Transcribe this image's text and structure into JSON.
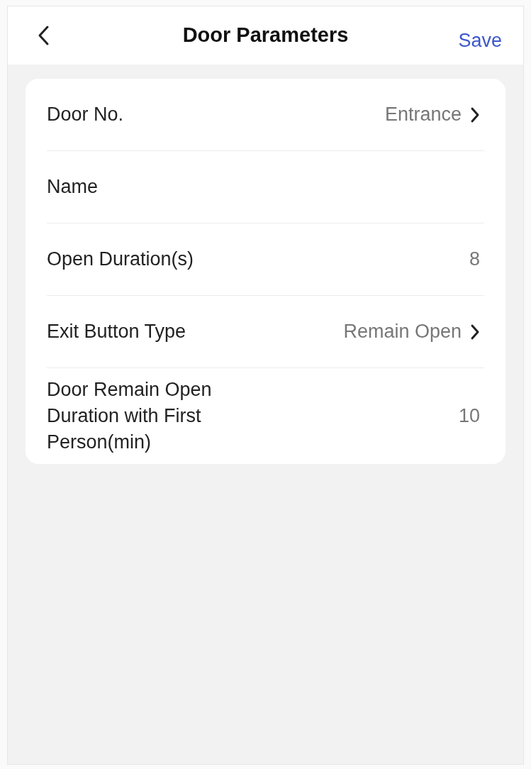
{
  "header": {
    "title": "Door Parameters",
    "action": "Save"
  },
  "rows": [
    {
      "kind": "select",
      "label": "Door No.",
      "value": "Entrance"
    },
    {
      "kind": "text",
      "label": "Name"
    },
    {
      "kind": "value",
      "label": "Open Duration(s)",
      "value": "8"
    },
    {
      "kind": "select",
      "label": "Exit Button Type",
      "value": "Remain Open"
    },
    {
      "kind": "value",
      "label": "Door Remain Open Duration with First Person(min)",
      "value": "10"
    }
  ]
}
